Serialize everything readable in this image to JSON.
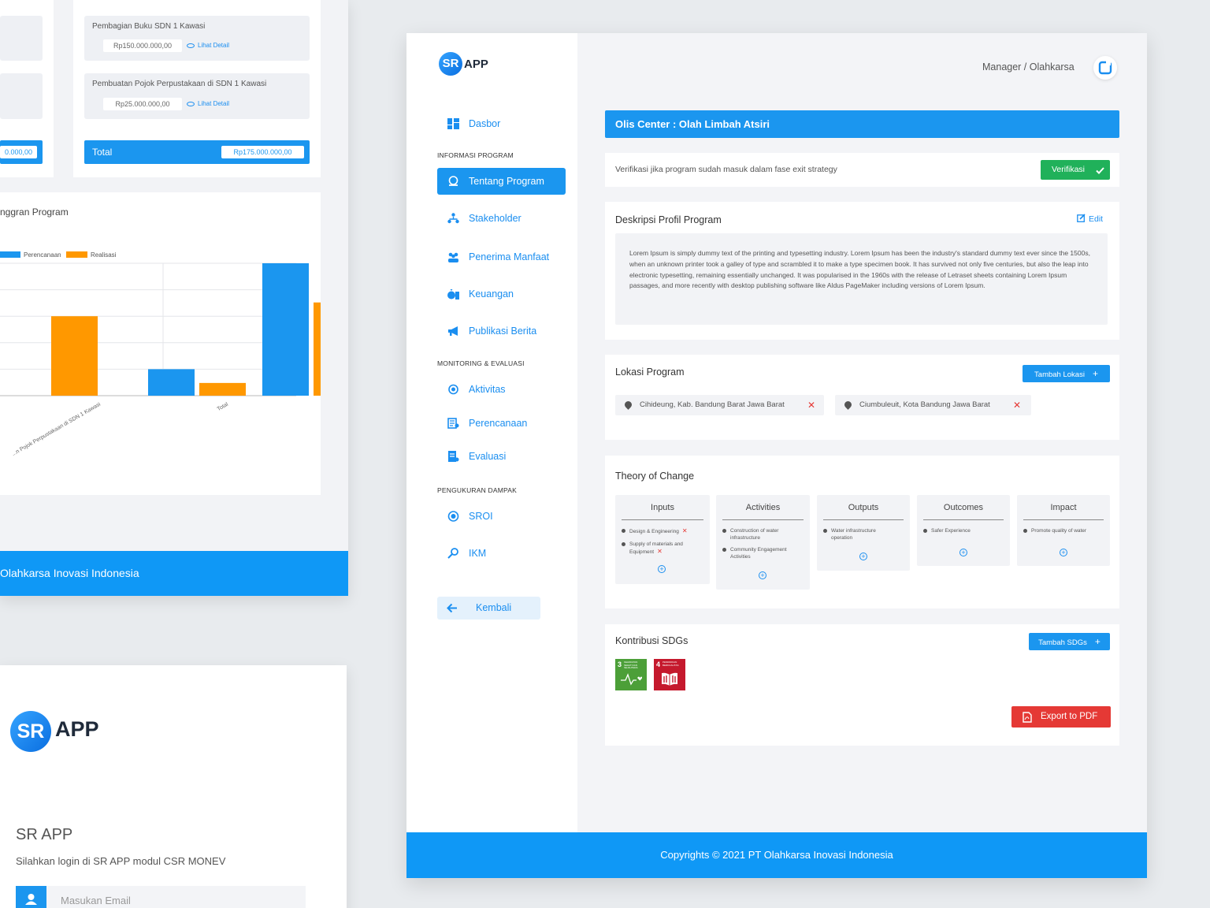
{
  "background_page": {
    "budget_items": [
      {
        "title": "Pembagian Buku SDN 1 Kawasi",
        "amount": "Rp150.000.000,00",
        "link": "Lihat Detail"
      },
      {
        "title": "Pembuatan Pojok Perpustakaan di SDN 1 Kawasi",
        "amount": "Rp25.000.000,00",
        "link": "Lihat Detail"
      }
    ],
    "left_total_value": "0.000,00",
    "total_label": "Total",
    "total_value": "Rp175.000.000,00",
    "chart_title": "nggran Program",
    "footer": "Olahkarsa Inovasi Indonesia",
    "chart_data": {
      "type": "bar",
      "categories": [
        "",
        "...n Pojok Perpustakaan di SDN 1 Kawasi",
        "Total"
      ],
      "series": [
        {
          "name": "Perencanaan",
          "color": "#1b96ef",
          "values": [
            null,
            25,
            125
          ]
        },
        {
          "name": "Realisasi",
          "color": "#ff9800",
          "values": [
            75,
            12,
            88
          ]
        }
      ],
      "ylim": [
        0,
        125
      ],
      "grid": true,
      "legend": "top-left"
    }
  },
  "login": {
    "logo_sr": "SR",
    "logo_app": "APP",
    "title": "SR APP",
    "subtitle": "Silahkan login di SR APP modul CSR MONEV",
    "email_placeholder": "Masukan Email"
  },
  "app": {
    "logo_sr": "SR",
    "logo_app": "APP",
    "user_role": "Manager / Olahkarsa",
    "nav": {
      "dasbor": "Dasbor",
      "section_info": "INFORMASI PROGRAM",
      "tentang": "Tentang Program",
      "stakeholder": "Stakeholder",
      "penerima": "Penerima Manfaat",
      "keuangan": "Keuangan",
      "publikasi": "Publikasi Berita",
      "section_monev": "MONITORING & EVALUASI",
      "aktivitas": "Aktivitas",
      "perencanaan": "Perencanaan",
      "evaluasi": "Evaluasi",
      "section_dampak": "PENGUKURAN DAMPAK",
      "sroi": "SROI",
      "ikm": "IKM",
      "back": "Kembali"
    },
    "program_title": "Olis Center : Olah Limbah Atsiri",
    "verify_text": "Verifikasi jika program sudah masuk dalam fase exit strategy",
    "verify_button": "Verifikasi",
    "description_title": "Deskripsi Profil Program",
    "edit_label": "Edit",
    "description": "Lorem Ipsum is simply dummy text of the printing and typesetting industry. Lorem Ipsum has been the industry's standard dummy text ever since the 1500s, when an unknown printer took a galley of type and scrambled it to make a type specimen book. It has survived not only five centuries, but also the leap into electronic typesetting, remaining essentially unchanged. It was popularised in the 1960s with the release of Letraset sheets containing Lorem Ipsum passages, and more recently with desktop publishing software like Aldus PageMaker including versions of Lorem Ipsum.",
    "location_title": "Lokasi Program",
    "add_location": "Tambah Lokasi",
    "locations": [
      "Cihideung, Kab. Bandung Barat Jawa Barat",
      "Ciumbuleuit, Kota Bandung Jawa Barat"
    ],
    "toc_title": "Theory of Change",
    "toc": [
      {
        "head": "Inputs",
        "items": [
          "Design & Engineering",
          "Supply of materials and Equipment"
        ]
      },
      {
        "head": "Activities",
        "items": [
          "Construction of water infrastructure",
          "Community Engagement Activities"
        ]
      },
      {
        "head": "Outputs",
        "items": [
          "Water infrastructure operation"
        ]
      },
      {
        "head": "Outcomes",
        "items": [
          "Safer Experience"
        ]
      },
      {
        "head": "Impact",
        "items": [
          "Promote quality of water"
        ]
      }
    ],
    "sdg_title": "Kontribusi SDGs",
    "add_sdg": "Tambah SDGs",
    "sdgs": [
      {
        "num": "3",
        "text": "KEHIDUPAN SEHAT DAN SEJAHTERA",
        "color": "#4c9f38"
      },
      {
        "num": "4",
        "text": "PENDIDIKAN BERKUALITAS",
        "color": "#c5192d"
      }
    ],
    "export_button": "Export to PDF",
    "footer": "Copyrights © 2021  PT Olahkarsa Inovasi Indonesia"
  }
}
